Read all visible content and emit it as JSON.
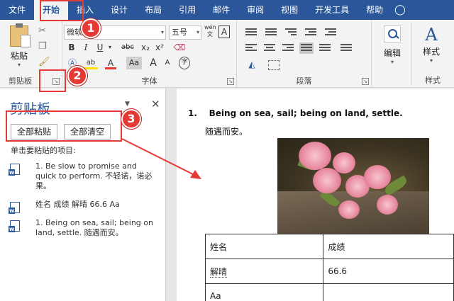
{
  "menubar": {
    "items": [
      "文件",
      "开始",
      "插入",
      "设计",
      "布局",
      "引用",
      "邮件",
      "审阅",
      "视图",
      "开发工具",
      "帮助"
    ],
    "active": "开始"
  },
  "ribbon": {
    "clipboard": {
      "paste_label": "粘贴",
      "group_label": "剪贴板"
    },
    "font": {
      "font_name": "微软",
      "font_size": "五号",
      "pinyin_label": "wén",
      "border_char": "A",
      "bold": "B",
      "italic": "I",
      "underline": "U",
      "strike": "abc",
      "subscript": "x₂",
      "superscript": "x²",
      "highlight": "ab",
      "font_color": "A",
      "char_shading": "Aa",
      "grow": "A",
      "shrink": "A",
      "enclose": "字",
      "group_label": "字体"
    },
    "paragraph": {
      "group_label": "段落"
    },
    "editing": {
      "label": "编辑"
    },
    "styles": {
      "label": "样式",
      "group_label": "样式",
      "glyph": "A"
    }
  },
  "pane": {
    "title": "剪贴板",
    "paste_all": "全部粘贴",
    "clear_all": "全部清空",
    "hint": "单击要粘贴的项目:",
    "items": [
      "1. Be slow to promise and quick to perform. 不轻诺，诺必果。",
      "姓名 成绩 解晴 66.6 Aa",
      "1. Being on sea, sail; being on land, settle. 随遇而安。"
    ]
  },
  "document": {
    "heading_num": "1.",
    "heading": "Being on sea, sail; being on land, settle.",
    "subtitle": "随遇而安。",
    "table": [
      [
        "姓名",
        "成绩"
      ],
      [
        "解晴",
        "66.6"
      ],
      [
        "Aa",
        ""
      ]
    ]
  },
  "annotations": {
    "b1": "1",
    "b2": "2",
    "b3": "3"
  },
  "colors": {
    "accent": "#2b579a",
    "annotation": "#e53935"
  }
}
